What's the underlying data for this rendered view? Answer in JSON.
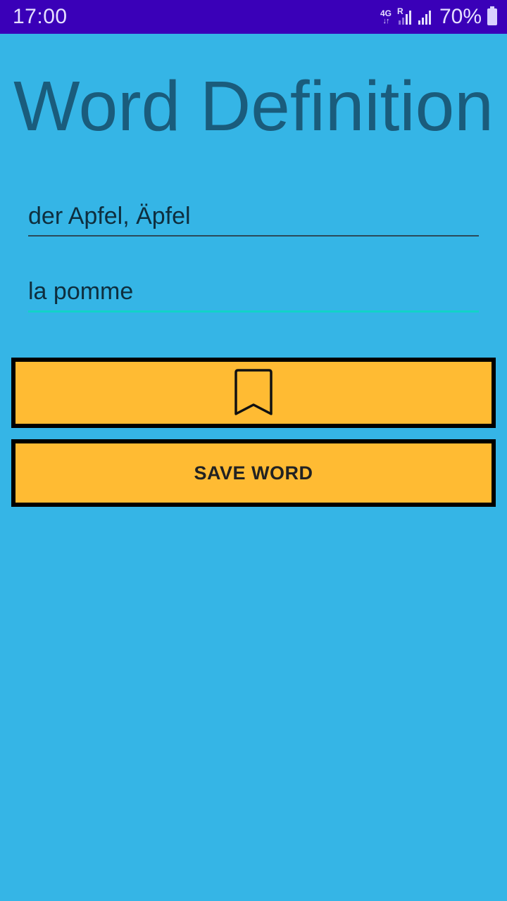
{
  "status_bar": {
    "time": "17:00",
    "network": "4G",
    "network_arrows": "↓↑",
    "roaming": "R",
    "battery": "70%"
  },
  "title": "Word Definition",
  "word_field": {
    "value": "der Apfel, Äpfel"
  },
  "definition_field": {
    "value": "la pomme"
  },
  "bookmark_button": {
    "icon": "bookmark-icon"
  },
  "save_button": {
    "label": "SAVE WORD"
  },
  "colors": {
    "background": "#35b5e6",
    "status_bar": "#3a00b8",
    "title": "#1a5c7c",
    "button": "#ffbb33",
    "accent_underline": "#12d3c8"
  }
}
